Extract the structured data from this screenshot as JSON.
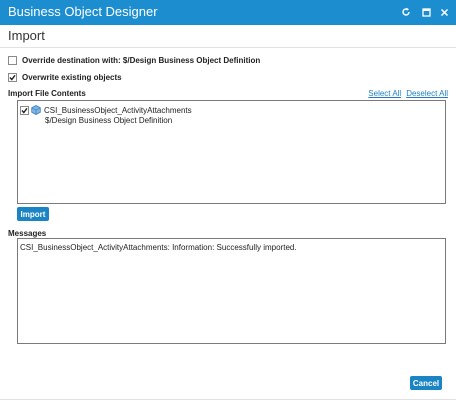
{
  "window": {
    "title": "Business Object Designer",
    "controls": {
      "refresh_icon": "refresh-icon",
      "maximize_icon": "maximize-icon",
      "close_icon": "close-icon"
    }
  },
  "page": {
    "title": "Import"
  },
  "options": {
    "override": {
      "label": "Override destination with: $/Design Business Object Definition",
      "checked": false
    },
    "overwrite": {
      "label": "Overwrite existing objects",
      "checked": true
    }
  },
  "import_contents": {
    "label": "Import File Contents",
    "select_all": "Select All",
    "deselect_all": "Deselect All",
    "items": [
      {
        "name": "CSI_BusinessObject_ActivityAttachments",
        "path": "$/Design Business Object Definition",
        "checked": true,
        "icon": "business-object-icon"
      }
    ]
  },
  "import_button": {
    "label": "Import"
  },
  "messages": {
    "label": "Messages",
    "text": "CSI_BusinessObject_ActivityAttachments: Information: Successfully imported."
  },
  "cancel_button": {
    "label": "Cancel"
  },
  "colors": {
    "titlebar": "#1c8ed0",
    "button": "#1b84c4",
    "link": "#1f7fc0"
  }
}
